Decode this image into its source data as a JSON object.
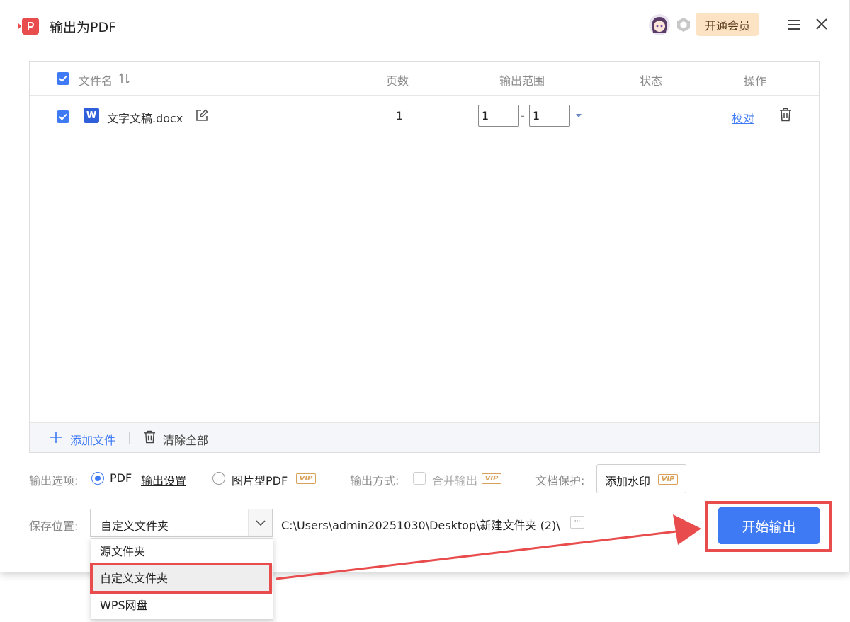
{
  "window": {
    "title": "输出为PDF",
    "vip_button": "开通会员"
  },
  "table": {
    "headers": {
      "filename": "文件名",
      "pages": "页数",
      "range": "输出范围",
      "status": "状态",
      "action": "操作"
    },
    "rows": [
      {
        "filename": "文字文稿.docx",
        "pages": "1",
        "range_from": "1",
        "range_to": "1",
        "range_sep": "-",
        "proofread": "校对",
        "file_icon_letter": "W"
      }
    ],
    "footer": {
      "add_file": "添加文件",
      "clear_all": "清除全部"
    }
  },
  "options": {
    "output_options_label": "输出选项:",
    "pdf_label": "PDF",
    "output_settings": "输出设置",
    "image_pdf_label": "图片型PDF",
    "vip_tag": "VIP",
    "output_method_label": "输出方式:",
    "merge_output": "合并输出",
    "doc_protect_label": "文档保护:",
    "add_watermark": "添加水印"
  },
  "save": {
    "label": "保存位置:",
    "selected": "自定义文件夹",
    "path": "C:\\Users\\admin20251030\\Desktop\\新建文件夹 (2)\\",
    "browse": "···",
    "options": [
      "源文件夹",
      "自定义文件夹",
      "WPS网盘"
    ]
  },
  "start_button": "开始输出",
  "colors": {
    "accent": "#3f7af5",
    "annotation": "#e84c4c",
    "vip": "#d9a25a"
  }
}
